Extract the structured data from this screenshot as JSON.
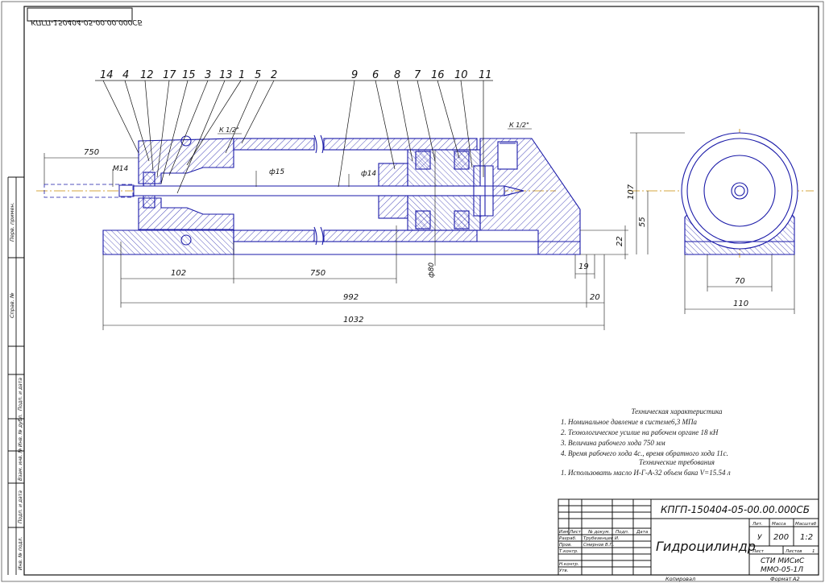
{
  "sheet": {
    "top_stamp": "КПГП-150404-05-00.00.000СБ",
    "side_labels": [
      "Перв. примен.",
      "Справ. №",
      "Подп. и дата",
      "Инв. № дубл.",
      "Взам. инв. №",
      "Подп. и дата",
      "Инв. № подл."
    ],
    "copied": "Копировал",
    "format_label": "Формат",
    "format_value": "А2"
  },
  "drawing": {
    "callouts": [
      "14",
      "4",
      "12",
      "17",
      "15",
      "3",
      "13",
      "1",
      "5",
      "2",
      "9",
      "6",
      "8",
      "7",
      "16",
      "10",
      "11"
    ],
    "thread_left": "К 1/2\"",
    "thread_right": "К 1/2\"",
    "dim_750_top": "750",
    "dim_m14": "М14",
    "dim_d15": "ф15",
    "dim_d14": "ф14",
    "dim_d80": "ф80",
    "dim_102": "102",
    "dim_750": "750",
    "dim_992": "992",
    "dim_20": "20",
    "dim_1032": "1032",
    "dim_19": "19",
    "dim_22": "22",
    "dim_107": "107",
    "dim_55": "55",
    "dim_70": "70",
    "dim_110": "110"
  },
  "tech": {
    "title": "Техническая характеристика",
    "items": [
      "1. Номинальное давление в системе6,3 МПа",
      "2. Технологическое усилие на рабочем органе 18 кН",
      "3. Величина рабочего хода 750 мм",
      "4. Время рабочего хода   4с., время обратного хода 11с."
    ],
    "req_title": "Технические требования",
    "req_items": [
      "1. Использовать масло И-Г-А-32        объем бака V=15.54 л"
    ]
  },
  "title_block": {
    "doc_number": "КПГП-150404-05-00.00.000СБ",
    "name": "Гидроцилиндр",
    "col_headers": [
      "Изм",
      "Лист",
      "№ докум.",
      "Подп.",
      "Дата"
    ],
    "roles": [
      "Разраб.",
      "Пров.",
      "Т.контр.",
      "",
      "Н.контр.",
      "Утв."
    ],
    "people": [
      "Трубезенцев И.",
      "Смирнов В.П."
    ],
    "lit_label": "Лит.",
    "mass_label": "Масса",
    "scale_label": "Масштаб",
    "mass": "200",
    "scale": "1:2",
    "lit_value": "У",
    "sheet_label": "Лист",
    "sheets_label": "Листов",
    "sheets_value": "1",
    "org_line1": "СТИ МИСиС",
    "org_line2": "ММО-05-1Л"
  }
}
